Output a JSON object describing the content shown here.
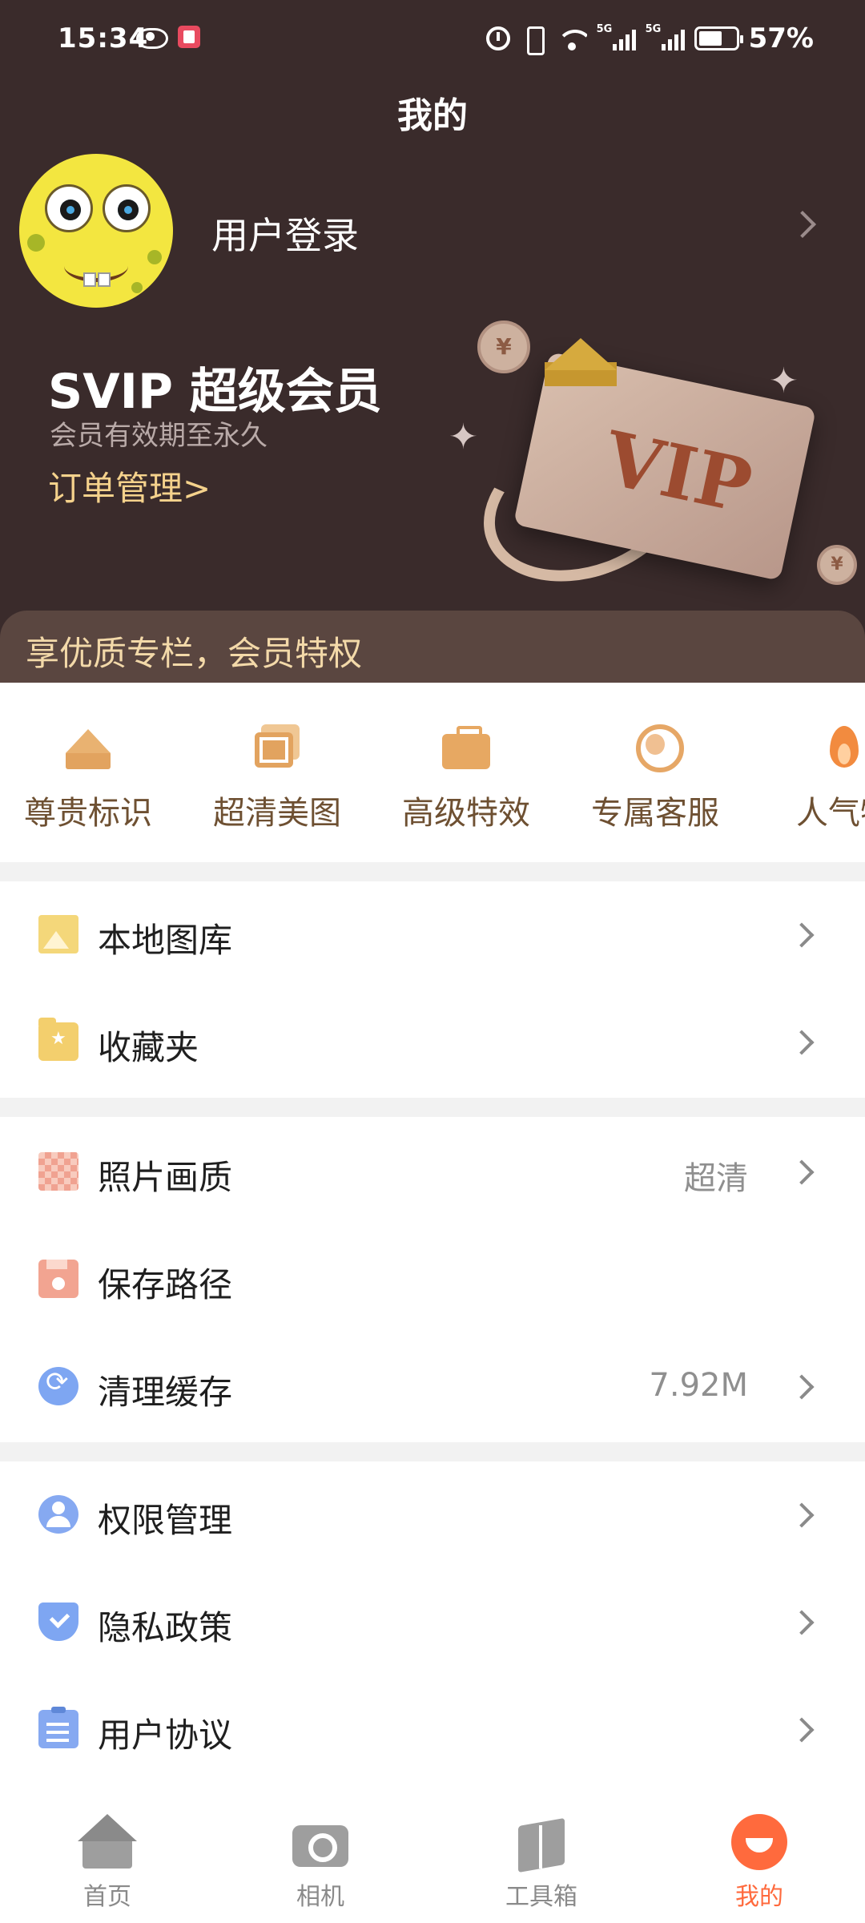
{
  "status_bar": {
    "time": "15:34",
    "battery": "57%",
    "signal_tag_1": "5G",
    "signal_tag_2": "5G"
  },
  "header": {
    "title": "我的",
    "login_label": "用户登录",
    "svip_title": "SVIP 超级会员",
    "svip_sub": "会员有效期至永久",
    "order_link": "订单管理>",
    "privilege_banner": "享优质专栏，会员特权",
    "vip_card_label": "VIP",
    "coin_symbol": "¥"
  },
  "privileges": [
    {
      "label": "尊贵标识",
      "icon": "crown-icon"
    },
    {
      "label": "超清美图",
      "icon": "hd-image-icon"
    },
    {
      "label": "高级特效",
      "icon": "briefcase-icon"
    },
    {
      "label": "专属客服",
      "icon": "headset-icon"
    },
    {
      "label": "人气特",
      "icon": "fire-icon"
    }
  ],
  "menu": {
    "gallery": "本地图库",
    "favorites": "收藏夹",
    "photo_quality": "照片画质",
    "photo_quality_value": "超清",
    "save_path": "保存路径",
    "clear_cache": "清理缓存",
    "cache_size": "7.92M",
    "permissions": "权限管理",
    "privacy": "隐私政策",
    "agreement": "用户协议"
  },
  "bottom_nav": {
    "home": "首页",
    "camera": "相机",
    "toolbox": "工具箱",
    "me": "我的",
    "active": "me",
    "active_color": "#ff6a3d"
  },
  "colors": {
    "header_bg": "#3a2b2b",
    "gold_text": "#f5d28c",
    "privilege_text": "#6e5032"
  }
}
